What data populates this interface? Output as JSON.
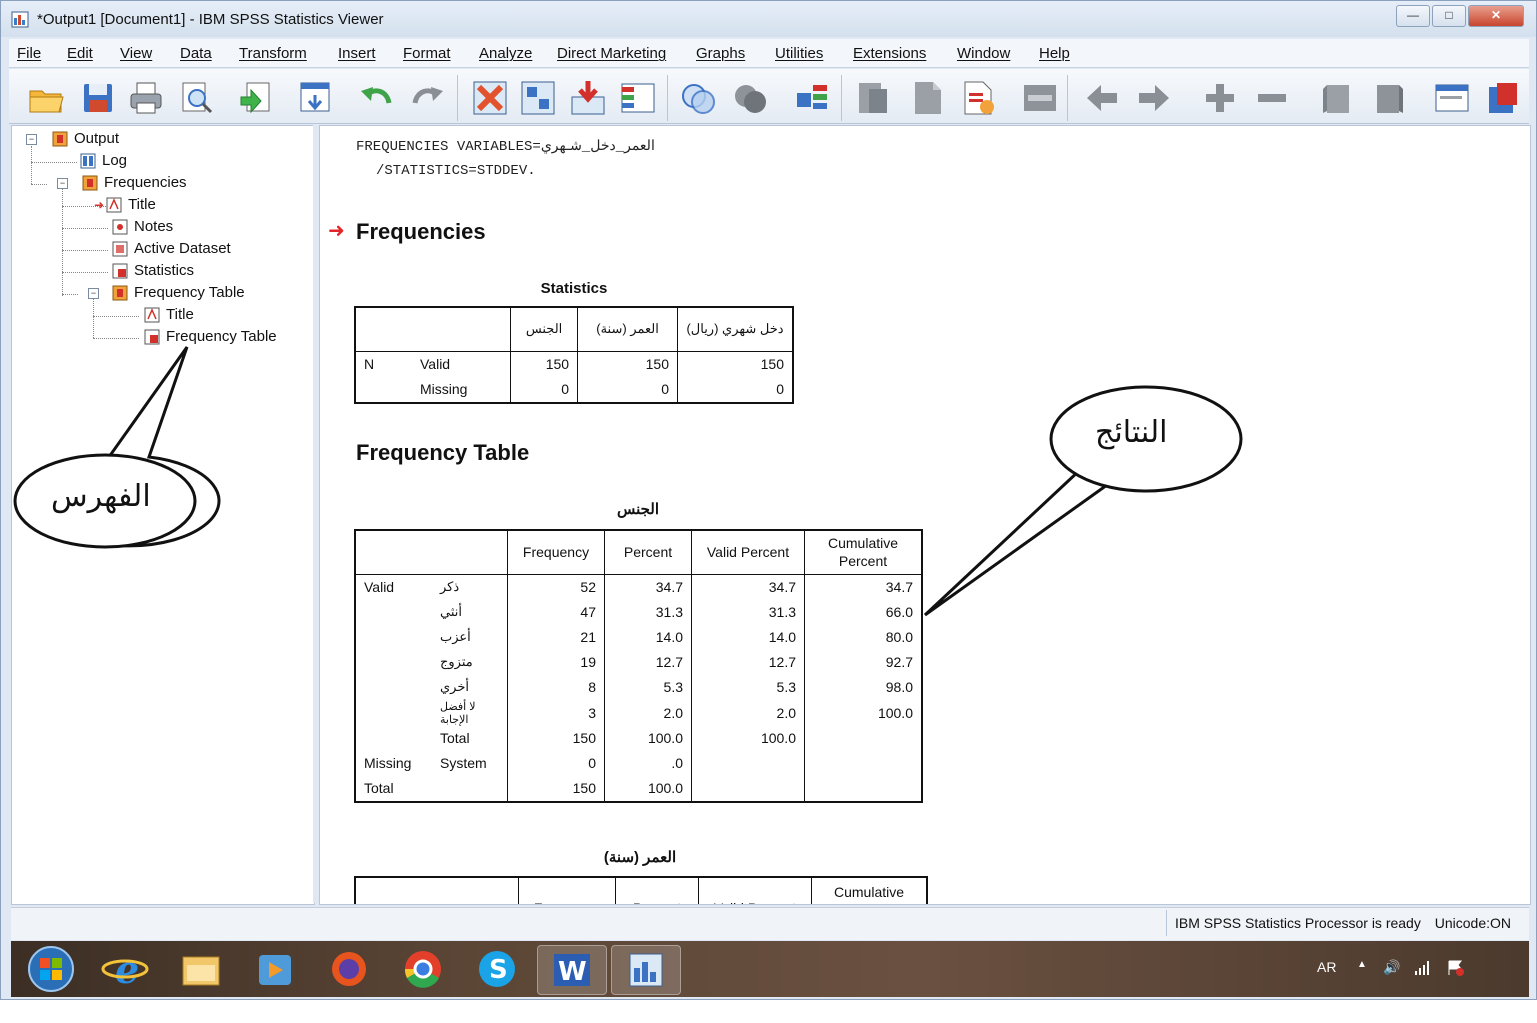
{
  "window": {
    "title": "*Output1 [Document1] - IBM SPSS Statistics Viewer",
    "buttons": {
      "minimize": "—",
      "maximize": "□",
      "close": "✕"
    }
  },
  "menu": [
    "File",
    "Edit",
    "View",
    "Data",
    "Transform",
    "Insert",
    "Format",
    "Analyze",
    "Direct Marketing",
    "Graphs",
    "Utilities",
    "Extensions",
    "Window",
    "Help"
  ],
  "toolbar_icons": [
    "open-icon",
    "save-icon",
    "print-icon",
    "print-preview-icon",
    "export-icon",
    "recall-dialog-icon",
    "undo-icon",
    "redo-icon",
    "goto-data-icon",
    "goto-case-icon",
    "goto-variable-icon",
    "variables-icon",
    "use-sets-icon",
    "show-all-variables-icon",
    "spelling-icon",
    "designate-window-icon",
    "pivot-icon",
    "create-edit-autoscript-icon",
    "run-script-icon",
    "insert-icon",
    "back-icon",
    "forward-icon",
    "expand-icon",
    "collapse-icon",
    "show-icon",
    "hide-icon",
    "insert-heading-icon",
    "insert-title-icon"
  ],
  "outline": {
    "root": "Output",
    "log": "Log",
    "frequencies": "Frequencies",
    "freq_children": [
      "Title",
      "Notes",
      "Active Dataset",
      "Statistics"
    ],
    "freq_table": "Frequency Table",
    "freq_table_children": [
      "Title",
      "Frequency Table"
    ]
  },
  "syntax": {
    "line1": "FREQUENCIES VARIABLES=العمر_دخل_شـهري",
    "line2": "/STATISTICS=STDDEV."
  },
  "heading": "Frequencies",
  "statistics_table": {
    "title": "Statistics",
    "columns": [
      "الجنس",
      "العمر (سنة)",
      "دخل شهري (ريال)"
    ],
    "rows": [
      {
        "label": "N",
        "sub": "Valid",
        "values": [
          "150",
          "150",
          "150"
        ]
      },
      {
        "label": "",
        "sub": "Missing",
        "values": [
          "0",
          "0",
          "0"
        ]
      }
    ]
  },
  "frequency_table_heading": "Frequency Table",
  "gender_table": {
    "title": "الجنس",
    "columns": [
      "Frequency",
      "Percent",
      "Valid Percent",
      "Cumulative Percent"
    ],
    "rows": [
      {
        "group": "Valid",
        "label": "ذكر",
        "values": [
          "52",
          "34.7",
          "34.7",
          "34.7"
        ]
      },
      {
        "group": "",
        "label": "أنثي",
        "values": [
          "47",
          "31.3",
          "31.3",
          "66.0"
        ]
      },
      {
        "group": "",
        "label": "أعزب",
        "values": [
          "21",
          "14.0",
          "14.0",
          "80.0"
        ]
      },
      {
        "group": "",
        "label": "متزوج",
        "values": [
          "19",
          "12.7",
          "12.7",
          "92.7"
        ]
      },
      {
        "group": "",
        "label": "أخري",
        "values": [
          "8",
          "5.3",
          "5.3",
          "98.0"
        ]
      },
      {
        "group": "",
        "label": "لا أفضل الإجابة",
        "values": [
          "3",
          "2.0",
          "2.0",
          "100.0"
        ]
      },
      {
        "group": "",
        "label": "Total",
        "values": [
          "150",
          "100.0",
          "100.0",
          ""
        ]
      },
      {
        "group": "Missing",
        "label": "System",
        "values": [
          "0",
          ".0",
          "",
          ""
        ]
      },
      {
        "group": "Total",
        "label": "",
        "values": [
          "150",
          "100.0",
          "",
          ""
        ]
      }
    ]
  },
  "age_table": {
    "title": "العمر (سنة)",
    "columns": [
      "Frequency",
      "Percent",
      "Valid Percent",
      "Cumulative"
    ]
  },
  "callouts": {
    "index": "الفهرس",
    "results": "النتائج"
  },
  "status": {
    "processor": "IBM SPSS Statistics Processor is ready",
    "unicode": "Unicode:ON"
  },
  "taskbar": {
    "apps": [
      "start-button",
      "internet-explorer-icon",
      "file-explorer-icon",
      "media-player-icon",
      "firefox-icon",
      "chrome-icon",
      "skype-icon",
      "word-icon",
      "spss-icon"
    ],
    "language": "AR"
  }
}
